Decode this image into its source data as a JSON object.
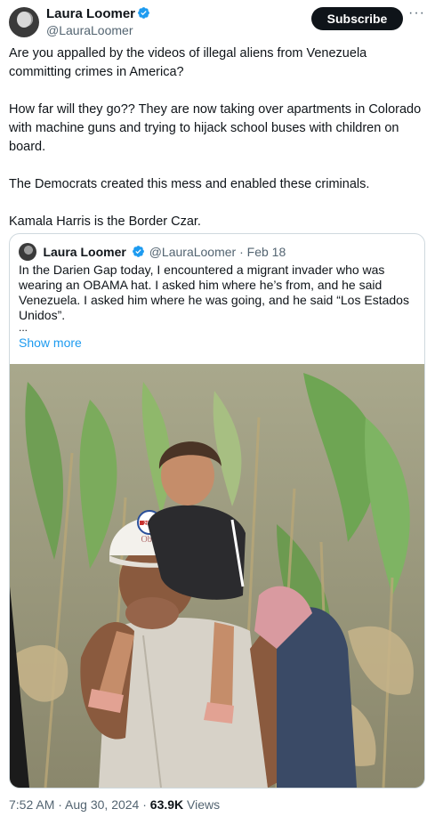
{
  "tweet": {
    "author_name": "Laura Loomer",
    "author_handle": "@LauraLoomer",
    "subscribe_label": "Subscribe",
    "more_label": "···",
    "paragraphs": [
      "Are you appalled by the videos of illegal aliens from Venezuela committing crimes in America?",
      "How far will they go?? They are now taking over apartments in Colorado with machine guns and trying to hijack school buses with children on board.",
      "The Democrats created this mess and enabled these criminals.",
      "Kamala Harris is the Border Czar."
    ],
    "time": "7:52 AM",
    "date": "Aug 30, 2024",
    "views_count": "63.9K",
    "views_label": "Views"
  },
  "quote": {
    "author_name": "Laura Loomer",
    "author_handle": "@LauraLoomer",
    "date": "Feb 18",
    "text": "In the Darien Gap today, I encountered a migrant invader who was wearing an OBAMA hat. I asked him where he’s from, and he said Venezuela. I asked him where he was going, and he said “Los Estados Unidos”.",
    "ellipsis": "...",
    "show_more": "Show more",
    "photo": {
      "hat_text": "Obama",
      "hat_badge": "2012"
    }
  },
  "colors": {
    "text": "#0f1419",
    "secondary": "#536471",
    "link": "#1d9bf0",
    "verified": "#1d9bf0",
    "border": "#cfd9de"
  },
  "icons": [
    "verified-badge-icon",
    "more-options-icon"
  ]
}
